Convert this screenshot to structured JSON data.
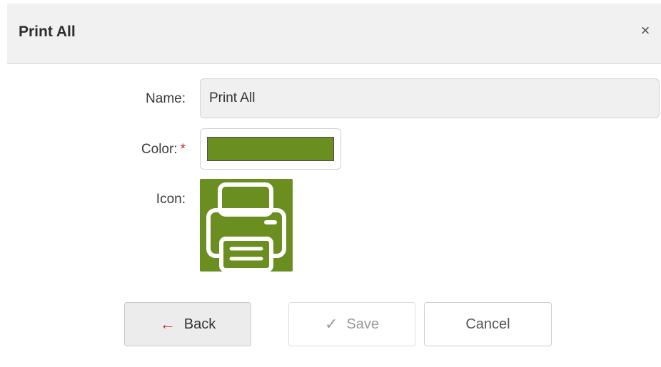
{
  "dialog": {
    "title": "Print All",
    "close_glyph": "×"
  },
  "form": {
    "name_label": "Name:",
    "name_value": "Print All",
    "color_label": "Color:",
    "color_required_mark": "*",
    "color_value": "#6a8e1f",
    "icon_label": "Icon:",
    "icon_name": "printer-icon"
  },
  "buttons": {
    "back_label": "Back",
    "back_icon": "arrow-left-icon",
    "save_label": "Save",
    "save_icon": "check-icon",
    "cancel_label": "Cancel"
  },
  "colors": {
    "accent_green": "#6a8e1f",
    "required_red": "#c62d3c",
    "back_arrow_red": "#d0283f"
  }
}
